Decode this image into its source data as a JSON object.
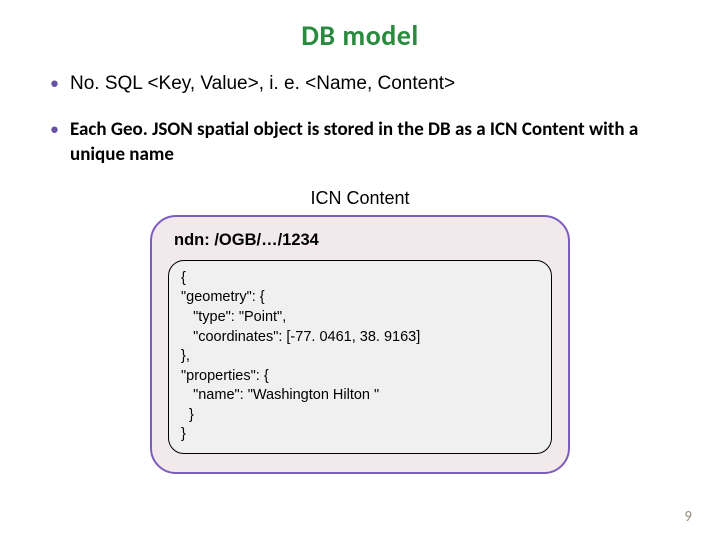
{
  "title": "DB model",
  "bullets": {
    "b1": "No. SQL <Key, Value>, i. e. <Name, Content>",
    "b2": "Each Geo. JSON spatial object is stored in the DB  as a ICN Content with a unique name"
  },
  "icn": {
    "label": "ICN Content",
    "ndn": "ndn: /OGB/…/1234",
    "json": "{\n\"geometry\": {\n   \"type\": \"Point\",\n   \"coordinates\": [-77. 0461, 38. 9163]\n},\n\"properties\": {\n   \"name\": \"Washington Hilton \"\n  }\n}"
  },
  "page_number": "9"
}
